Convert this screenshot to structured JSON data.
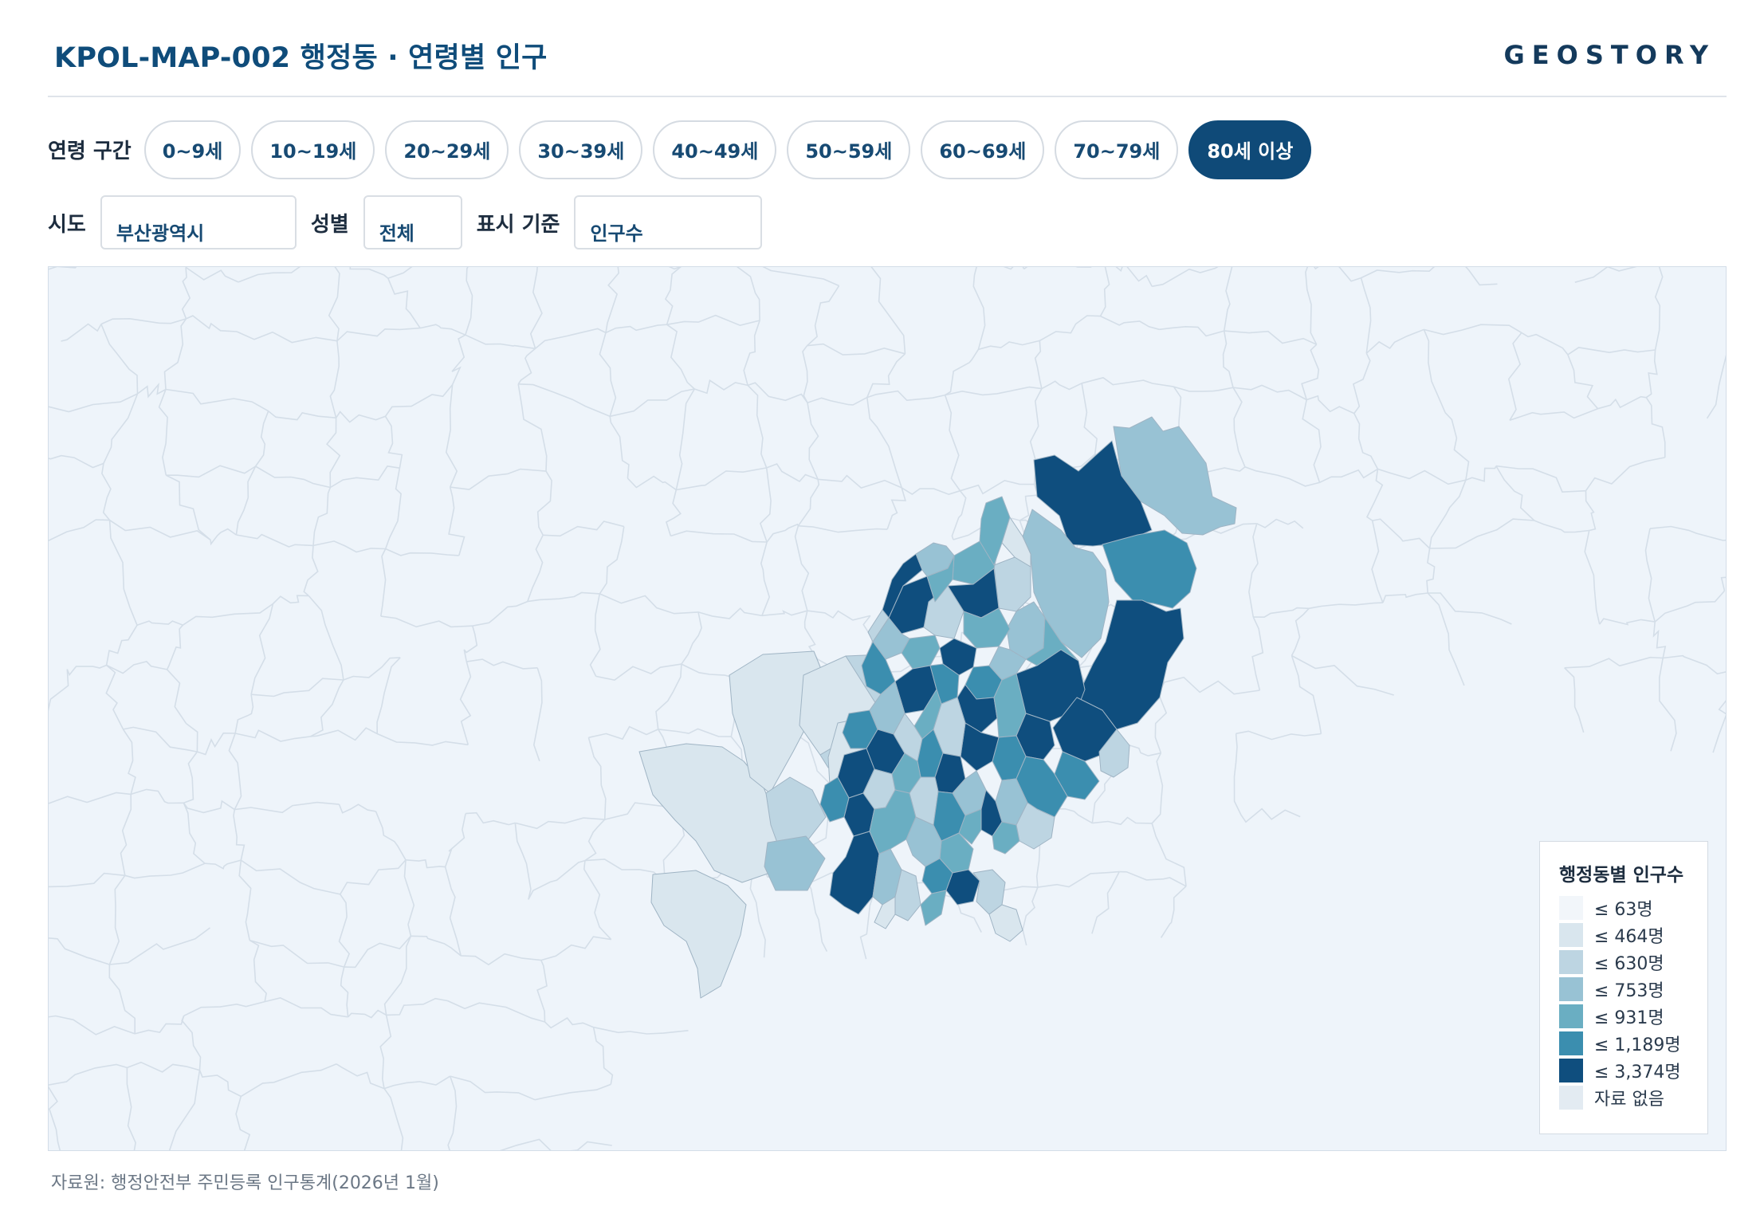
{
  "header": {
    "title": "KPOL-MAP-002 행정동 · 연령별 인구",
    "brand": "GEOSTORY"
  },
  "age_filter": {
    "label": "연령 구간",
    "options": [
      "0~9세",
      "10~19세",
      "20~29세",
      "30~39세",
      "40~49세",
      "50~59세",
      "60~69세",
      "70~79세",
      "80세 이상"
    ],
    "selected": "80세 이상"
  },
  "filters": {
    "sido_label": "시도",
    "sido_value": "부산광역시",
    "gender_label": "성별",
    "gender_value": "전체",
    "metric_label": "표시 기준",
    "metric_value": "인구수"
  },
  "legend": {
    "title": "행정동별 인구수",
    "items": [
      {
        "label": "≤ 63명",
        "color": "#f2f6fa"
      },
      {
        "label": "≤ 464명",
        "color": "#d9e6ee"
      },
      {
        "label": "≤ 630명",
        "color": "#bdd5e2"
      },
      {
        "label": "≤ 753명",
        "color": "#98c2d4"
      },
      {
        "label": "≤ 931명",
        "color": "#6aaec2"
      },
      {
        "label": "≤ 1,189명",
        "color": "#3b8eaf"
      },
      {
        "label": "≤ 3,374명",
        "color": "#0f4e7e"
      },
      {
        "label": "자료 없음",
        "color": "#e3ebf2"
      }
    ]
  },
  "map": {
    "background_color": "#eef4fa",
    "context_line_color": "#d4dee8",
    "region_stroke_color": "#9fb4c4"
  },
  "source": "자료원: 행정안전부 주민등록 인구통계(2026년 1월)"
}
